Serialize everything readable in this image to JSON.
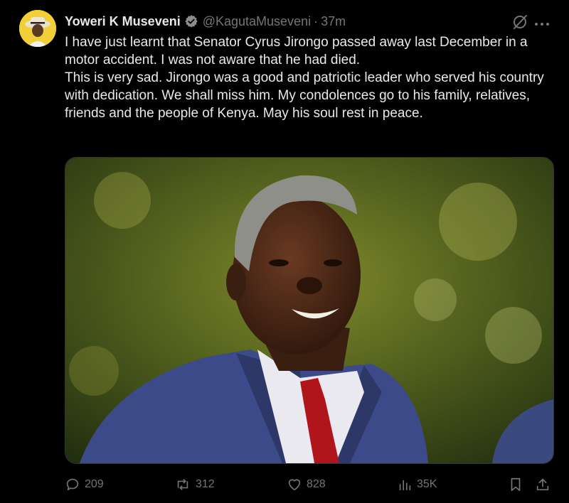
{
  "author": {
    "name": "Yoweri K Museveni",
    "handle": "@KagutaMuseveni",
    "separator": "·",
    "time": "37m"
  },
  "tweet": {
    "text_line1": "I have just learnt that Senator Cyrus Jirongo passed away last December in a motor accident. I was not aware that he had died.",
    "text_line2": "This is very sad. Jirongo was a good and patriotic leader who served his country with dedication. We shall miss him. My condolences go to his family, relatives, friends and the people of Kenya. May his soul rest in peace."
  },
  "actions": {
    "replies": "209",
    "reposts": "312",
    "likes": "828",
    "views": "35K"
  },
  "colors": {
    "background": "#000000",
    "text": "#e7e9ea",
    "muted": "#71767b",
    "verified": "#1d9bf0"
  },
  "icons": {
    "verified": "verified-badge-icon",
    "grok": "grok-icon",
    "more": "more-icon",
    "reply": "reply-icon",
    "repost": "repost-icon",
    "like": "heart-icon",
    "views": "views-icon",
    "bookmark": "bookmark-icon",
    "share": "share-icon"
  }
}
